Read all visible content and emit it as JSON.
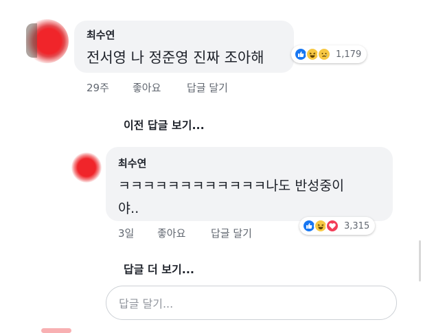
{
  "colors": {
    "bubble_bg": "#f2f3f5",
    "meta_text": "#616770",
    "like_blue": "#1877f2",
    "haha_yellow": "#f7c843",
    "love_red": "#f33e58"
  },
  "comment": {
    "author": "최수연",
    "text": "전서영 나 정준영 진짜 조아해",
    "time": "29주",
    "like_label": "좋아요",
    "reply_label": "답글 달기",
    "reactions": [
      "like-icon",
      "haha-icon",
      "sad-icon"
    ],
    "reaction_count": "1,179"
  },
  "view_previous_replies": "이전 답글 보기...",
  "reply": {
    "author": "최수연",
    "text_line1": "ㅋㅋㅋㅋㅋㅋㅋㅋㅋㅋㅋㅋ나도 반성중이",
    "text_line2": "야..",
    "time": "3일",
    "like_label": "좋아요",
    "reply_label": "답글 달기",
    "reactions": [
      "like-icon",
      "haha-icon",
      "love-icon"
    ],
    "reaction_count": "3,315"
  },
  "more_replies": "답글 더 보기...",
  "reply_input": {
    "placeholder": "답글 달기..."
  }
}
